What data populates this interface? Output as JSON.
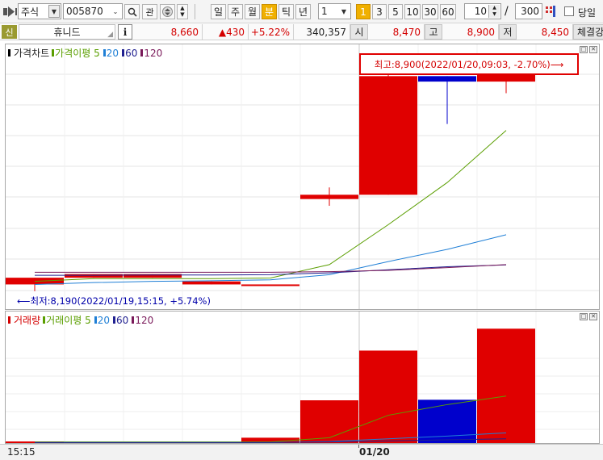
{
  "toolbar": {
    "market_type": "주식",
    "stock_code": "005870",
    "watch_label": "관",
    "period_buttons": [
      "일",
      "주",
      "월",
      "분",
      "틱",
      "년"
    ],
    "period_selected": "분",
    "interval_value": "1",
    "minute_buttons": [
      "1",
      "3",
      "5",
      "10",
      "30",
      "60"
    ],
    "minute_selected": "1",
    "count_value": "10",
    "count_total": "300",
    "same_day_label": "당일",
    "same_day_checked": false
  },
  "quote": {
    "badge": "신",
    "name": "휴니드",
    "info_label": "i",
    "price": "8,660",
    "change": "▲430",
    "change_pct": "+5.22%",
    "volume": "340,357",
    "open_label": "시",
    "open": "8,470",
    "high_label": "고",
    "high": "8,900",
    "low_label": "저",
    "low": "8,450",
    "trade_label": "체결강"
  },
  "price_panel": {
    "title": "가격차트",
    "legend": [
      {
        "label": "가격이평 5",
        "color": "#5a9e00"
      },
      {
        "label": "20",
        "color": "#1f7fd6"
      },
      {
        "label": "60",
        "color": "#202090"
      },
      {
        "label": "120",
        "color": "#7a1a5a"
      }
    ],
    "high_annotation": "최고:8,900(2022/01/20,09:03, -2.70%)⟶",
    "low_annotation": "⟵최저:8,190(2022/01/19,15:15, +5.74%)"
  },
  "volume_panel": {
    "title": "거래량",
    "legend": [
      {
        "label": "거래이평 5",
        "color": "#5a9e00"
      },
      {
        "label": "20",
        "color": "#1f7fd6"
      },
      {
        "label": "60",
        "color": "#202090"
      },
      {
        "label": "120",
        "color": "#7a1a5a"
      }
    ]
  },
  "xaxis": {
    "left_time": "15:15",
    "date_label": "01/20"
  },
  "colors": {
    "up": "#e00000",
    "down": "#0000cc",
    "ma5": "#5a9e00",
    "ma20": "#1f7fd6",
    "ma60": "#202090",
    "ma120": "#7a1a5a"
  },
  "chart_data": {
    "type": "candlestick",
    "price": {
      "candles": [
        {
          "open": 8190,
          "high": 8212,
          "low": 8168,
          "close": 8212,
          "color": "up"
        },
        {
          "open": 8212,
          "high": 8224,
          "low": 8212,
          "close": 8224,
          "color": "up"
        },
        {
          "open": 8212,
          "high": 8224,
          "low": 8212,
          "close": 8224,
          "color": "up"
        },
        {
          "open": 8190,
          "high": 8200,
          "low": 8190,
          "close": 8200,
          "color": "up"
        },
        {
          "open": 8190,
          "high": 8190,
          "low": 8190,
          "close": 8190,
          "color": "up"
        },
        {
          "open": 8470,
          "high": 8508,
          "low": 8448,
          "close": 8484,
          "color": "up"
        },
        {
          "open": 8484,
          "high": 8887,
          "low": 8484,
          "close": 8873,
          "color": "up"
        },
        {
          "open": 8873,
          "high": 8873,
          "low": 8716,
          "close": 8855,
          "color": "down"
        },
        {
          "open": 8855,
          "high": 8900,
          "low": 8817,
          "close": 8905,
          "color": "up"
        }
      ],
      "ma5": [
        8200,
        8209,
        8209,
        8209,
        8211,
        8255,
        8386,
        8524,
        8695
      ],
      "ma20": [
        8190,
        8196,
        8200,
        8202,
        8205,
        8222,
        8265,
        8305,
        8353
      ],
      "ma60": [
        8220,
        8220,
        8221,
        8221,
        8222,
        8228,
        8238,
        8248,
        8254
      ],
      "ma120": [
        8230,
        8230,
        8230,
        8230,
        8230,
        8232,
        8236,
        8245,
        8255
      ],
      "ylim": [
        8170,
        8940
      ]
    },
    "volume": {
      "bars": [
        {
          "value": 3,
          "color": "up"
        },
        {
          "value": 2,
          "color": "up"
        },
        {
          "value": 2,
          "color": "up"
        },
        {
          "value": 1,
          "color": "up"
        },
        {
          "value": 10,
          "color": "up"
        },
        {
          "value": 80,
          "color": "up"
        },
        {
          "value": 173,
          "color": "up"
        },
        {
          "value": 81,
          "color": "down"
        },
        {
          "value": 214,
          "color": "up"
        }
      ],
      "ma5": [
        2,
        2,
        2,
        2,
        2,
        10,
        52,
        72,
        88,
        112
      ],
      "ma20": [
        1,
        1,
        1,
        1,
        1,
        3,
        8,
        13,
        19
      ],
      "ma60": [
        1,
        1,
        1,
        1,
        1,
        2,
        4,
        6,
        8
      ],
      "ylim": [
        0,
        225
      ]
    }
  }
}
